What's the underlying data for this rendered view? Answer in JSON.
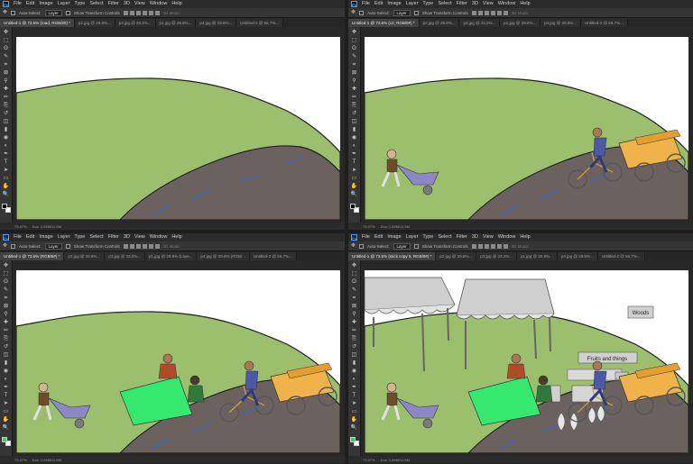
{
  "app": {
    "logo": "Ps"
  },
  "menu": [
    "File",
    "Edit",
    "Image",
    "Layer",
    "Type",
    "Select",
    "Filter",
    "3D",
    "View",
    "Window",
    "Help"
  ],
  "options": {
    "move_icon": "move-tool-icon",
    "auto_select": "Auto-Select:",
    "layer_select": "Layer",
    "transform_controls": "Show Transform Controls",
    "mode_3d": "3D Mode:"
  },
  "colors": {
    "grass": "#9bbf6d",
    "road": "#6b6260",
    "green_cloth": "#35e86e",
    "accent_fg": "#2fd16a"
  },
  "panes": [
    {
      "tabs": [
        "Untitled-1 @ 73.5% (road, RGB/8#) *",
        "p2.jpg @ 29.8%...",
        "p3.jpg @ 33.2%...",
        "p1.jpg @ 29.8%...",
        "p4.jpg @ 29.8%...",
        "Untitled-2 @ 66.7%..."
      ],
      "status": {
        "zoom": "73.47%",
        "doc": "Doc: 1.65M/11.5M"
      }
    },
    {
      "tabs": [
        "Untitled-1 @ 73.5% (c2, RGB/8#) *",
        "p2.jpg @ 29.8%...",
        "p3.jpg @ 33.2%...",
        "p1.jpg @ 29.8%...",
        "p4.jpg @ 29.8%...",
        "Untitled-2 @ 66.7%..."
      ],
      "status": {
        "zoom": "73.47%",
        "doc": "Doc: 1.65M/11.5M"
      }
    },
    {
      "tabs": [
        "Untitled-1 @ 73.5% (RGB/8#) *",
        "p2.jpg @ 29.8%...",
        "p3.jpg @ 33.2%...",
        "p1.jpg @ 29.8% (Laye...",
        "p4.jpg @ 29.8% (RGB/...",
        "Untitled-2 @ 66.7%..."
      ],
      "status": {
        "zoom": "73.47%",
        "doc": "Doc: 1.65M/11.5M"
      }
    },
    {
      "tabs": [
        "Untitled-1 @ 73.5% (stick copy 5, RGB/8#) *",
        "p2.jpg @ 29.8%...",
        "p3.jpg @ 33.2%...",
        "p1.jpg @ 29.8%...",
        "p4.jpg @ 29.8%...",
        "Untitled-2 @ 66.7%..."
      ],
      "status": {
        "zoom": "73.47%",
        "doc": "Doc: 1.65M/11.5M"
      }
    }
  ],
  "artwork": {
    "sign_woods": "Woods",
    "sign_fruits": "Fruits and things"
  },
  "tools": [
    "move-tool-icon",
    "marquee-tool-icon",
    "lasso-tool-icon",
    "quick-select-icon",
    "crop-tool-icon",
    "frame-tool-icon",
    "eyedropper-icon",
    "healing-brush-icon",
    "brush-tool-icon",
    "clone-stamp-icon",
    "history-brush-icon",
    "eraser-icon",
    "gradient-icon",
    "blur-icon",
    "dodge-icon",
    "pen-tool-icon",
    "type-tool-icon",
    "path-select-icon",
    "shape-tool-icon",
    "hand-tool-icon",
    "zoom-tool-icon"
  ]
}
